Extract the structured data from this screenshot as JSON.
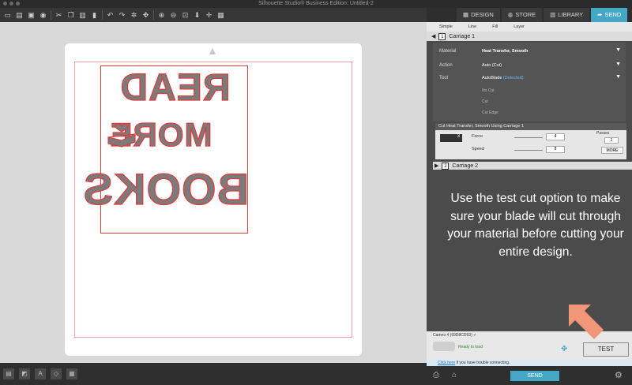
{
  "window": {
    "title": "Silhouette Studio® Business Edition: Untitled-2"
  },
  "tabs": [
    {
      "label": "DESIGN"
    },
    {
      "label": "STORE"
    },
    {
      "label": "LIBRARY"
    },
    {
      "label": "SEND",
      "active": true
    }
  ],
  "design_words": [
    "READ",
    "MORE",
    "BOOKS"
  ],
  "panel": {
    "modes": [
      "Simple",
      "Line",
      "Fill",
      "Layer"
    ],
    "carriage1": {
      "label": "Carriage 1",
      "material_label": "Material",
      "material_value": "Heat Transfer, Smooth",
      "action_label": "Action",
      "action_value": "Auto (Cut)",
      "tool_label": "Tool",
      "tool_value": "AutoBlade",
      "tool_detected": "(Detected)",
      "blades": [
        "No Cut",
        "Cut",
        "Cut Edge"
      ]
    },
    "cut_settings": {
      "header": "Cut Heat Transfer, Smooth Using Carriage 1",
      "blade_depth": "3",
      "force_label": "Force",
      "force_value": "4",
      "speed_label": "Speed",
      "speed_value": "8",
      "passes_label": "Passes",
      "passes_value": "1",
      "more_label": "MORE"
    },
    "carriage2": {
      "label": "Carriage 2"
    },
    "instruction": "Use the test cut option to make sure your blade will cut through your material before cutting your entire design.",
    "status": {
      "machine": "Cameo 4 (69D8CD93)",
      "ready": "Ready to load",
      "test_label": "TEST"
    },
    "help": {
      "link": "Click here",
      "text": "if you have trouble connecting."
    },
    "send_label": "SEND"
  },
  "colors": {
    "accent": "#44a7c6",
    "cutline": "#e03b3b",
    "pointer": "#f2967a"
  }
}
